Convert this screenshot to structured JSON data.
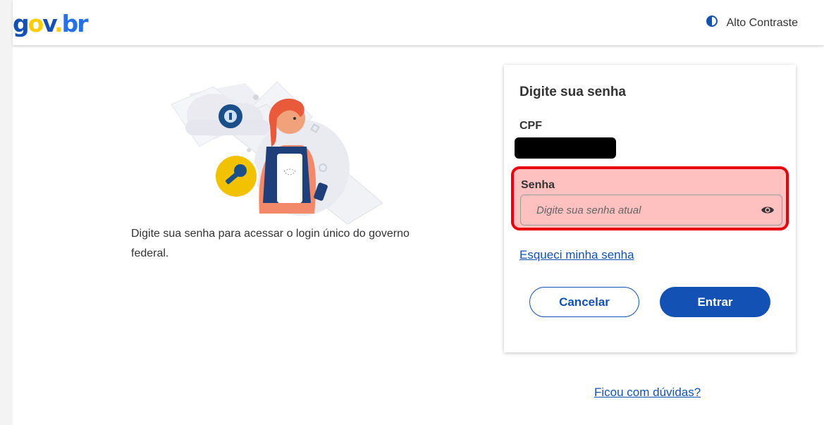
{
  "header": {
    "logo_text": "gov.br",
    "contrast_label": "Alto Contraste",
    "contrast_icon": "half-circle-contrast-icon"
  },
  "intro": {
    "text": "Digite sua senha para acessar o login único do governo federal."
  },
  "card": {
    "title": "Digite sua senha",
    "cpf_label": "CPF",
    "cpf_value": "",
    "password_label": "Senha",
    "password_placeholder": "Digite sua senha atual",
    "password_icon": "eye-icon",
    "forgot_link": "Esqueci minha senha",
    "cancel_label": "Cancelar",
    "enter_label": "Entrar"
  },
  "help_link": "Ficou com dúvidas?",
  "colors": {
    "primary": "#1351b4",
    "highlight_border": "#e8000f",
    "highlight_fill": "#ffc0c0",
    "logo_yellow": "#ffcd07"
  }
}
